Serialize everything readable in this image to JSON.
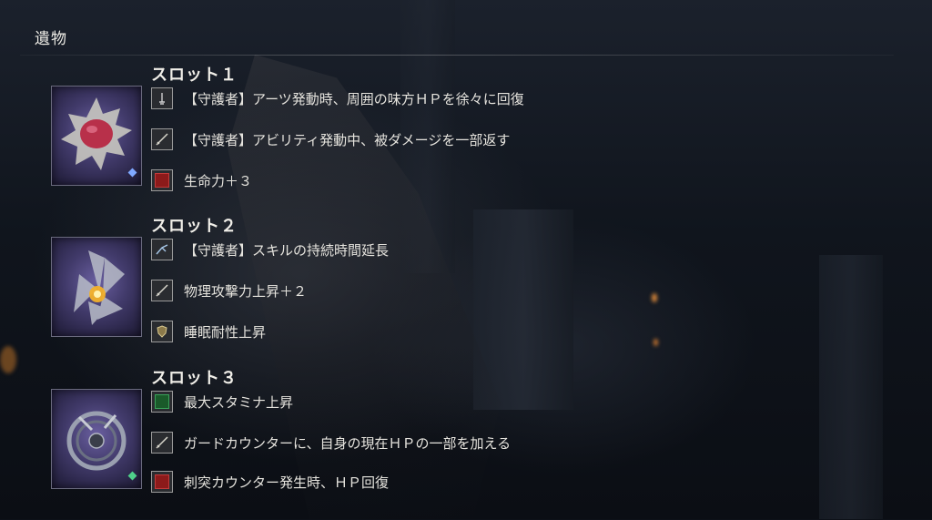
{
  "screen": {
    "title": "遺物"
  },
  "slots": [
    {
      "title": "スロット１",
      "relic": {
        "icon": "red-gem-brooch-icon",
        "color": "#b8304a",
        "gem_color": "#7fa8ff"
      },
      "effects": [
        {
          "icon": "staff-icon",
          "text": "【守護者】アーツ発動時、周囲の味方ＨＰを徐々に回復"
        },
        {
          "icon": "sword-icon",
          "text": "【守護者】アビリティ発動中、被ダメージを一部返す"
        },
        {
          "icon": "red-square-icon",
          "text": "生命力＋３"
        }
      ]
    },
    {
      "title": "スロット２",
      "relic": {
        "icon": "crystal-shard-icon",
        "color": "#f2b02a",
        "gem_color": null
      },
      "effects": [
        {
          "icon": "skill-icon",
          "text": "【守護者】スキルの持続時間延長"
        },
        {
          "icon": "sword-icon",
          "text": "物理攻撃力上昇＋２"
        },
        {
          "icon": "shield-icon",
          "text": "睡眠耐性上昇"
        }
      ]
    },
    {
      "title": "スロット３",
      "relic": {
        "icon": "ornate-ring-icon",
        "color": "#9aa0b0",
        "gem_color": "#4fd08a"
      },
      "effects": [
        {
          "icon": "green-square-icon",
          "text": "最大スタミナ上昇"
        },
        {
          "icon": "sword-icon",
          "text": "ガードカウンターに、自身の現在ＨＰの一部を加える"
        },
        {
          "icon": "red-square-icon",
          "text": "刺突カウンター発生時、ＨＰ回復"
        }
      ]
    }
  ]
}
